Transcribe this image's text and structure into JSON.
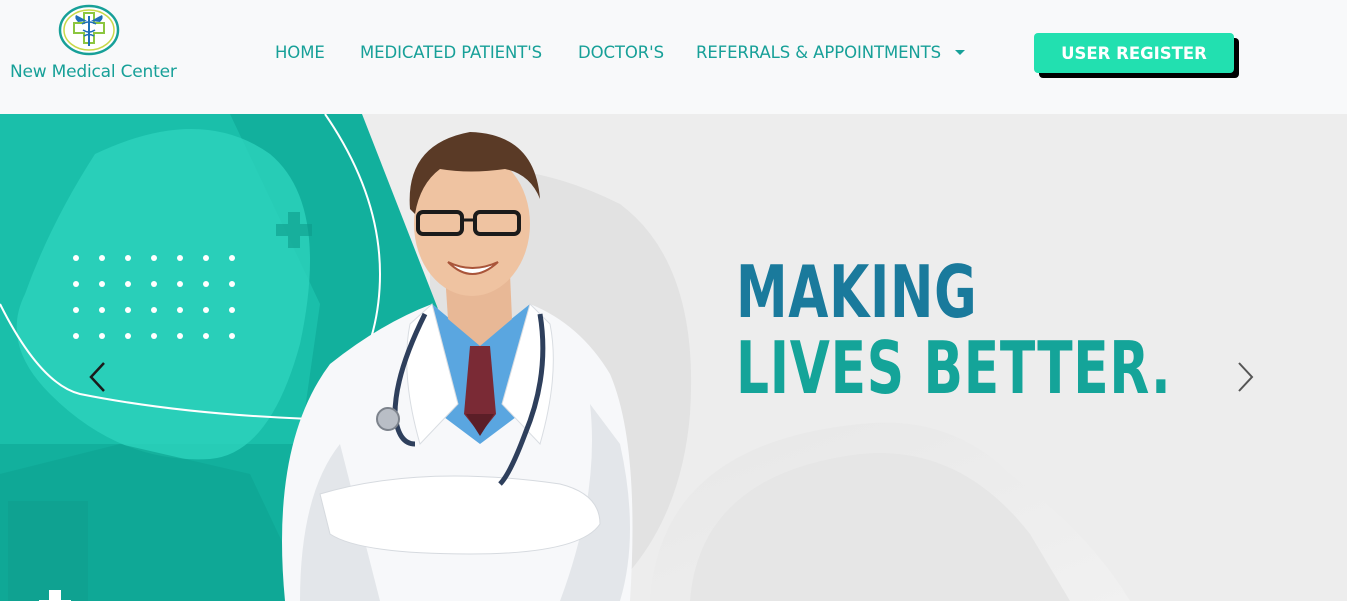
{
  "brand": {
    "name": "New Medical Center",
    "logo_icon": "caduceus-cross-icon"
  },
  "nav": {
    "items": [
      {
        "label": "HOME"
      },
      {
        "label": "MEDICATED PATIENT'S"
      },
      {
        "label": "DOCTOR'S"
      },
      {
        "label": "REFERRALS & APPOINTMENTS",
        "has_dropdown": true
      }
    ],
    "register_label": "USER REGISTER"
  },
  "hero": {
    "headline_line1": "MAKING",
    "headline_line2": "LIVES BETTER.",
    "prev_icon": "chevron-left-icon",
    "next_icon": "chevron-right-icon",
    "image_subject": "smiling-doctor-photo"
  },
  "colors": {
    "brand_teal": "#17a098",
    "register_button": "#22e0b0",
    "headline_blue": "#1a7a9c",
    "headline_teal": "#14a499",
    "hero_teal": "#10b3a0"
  }
}
